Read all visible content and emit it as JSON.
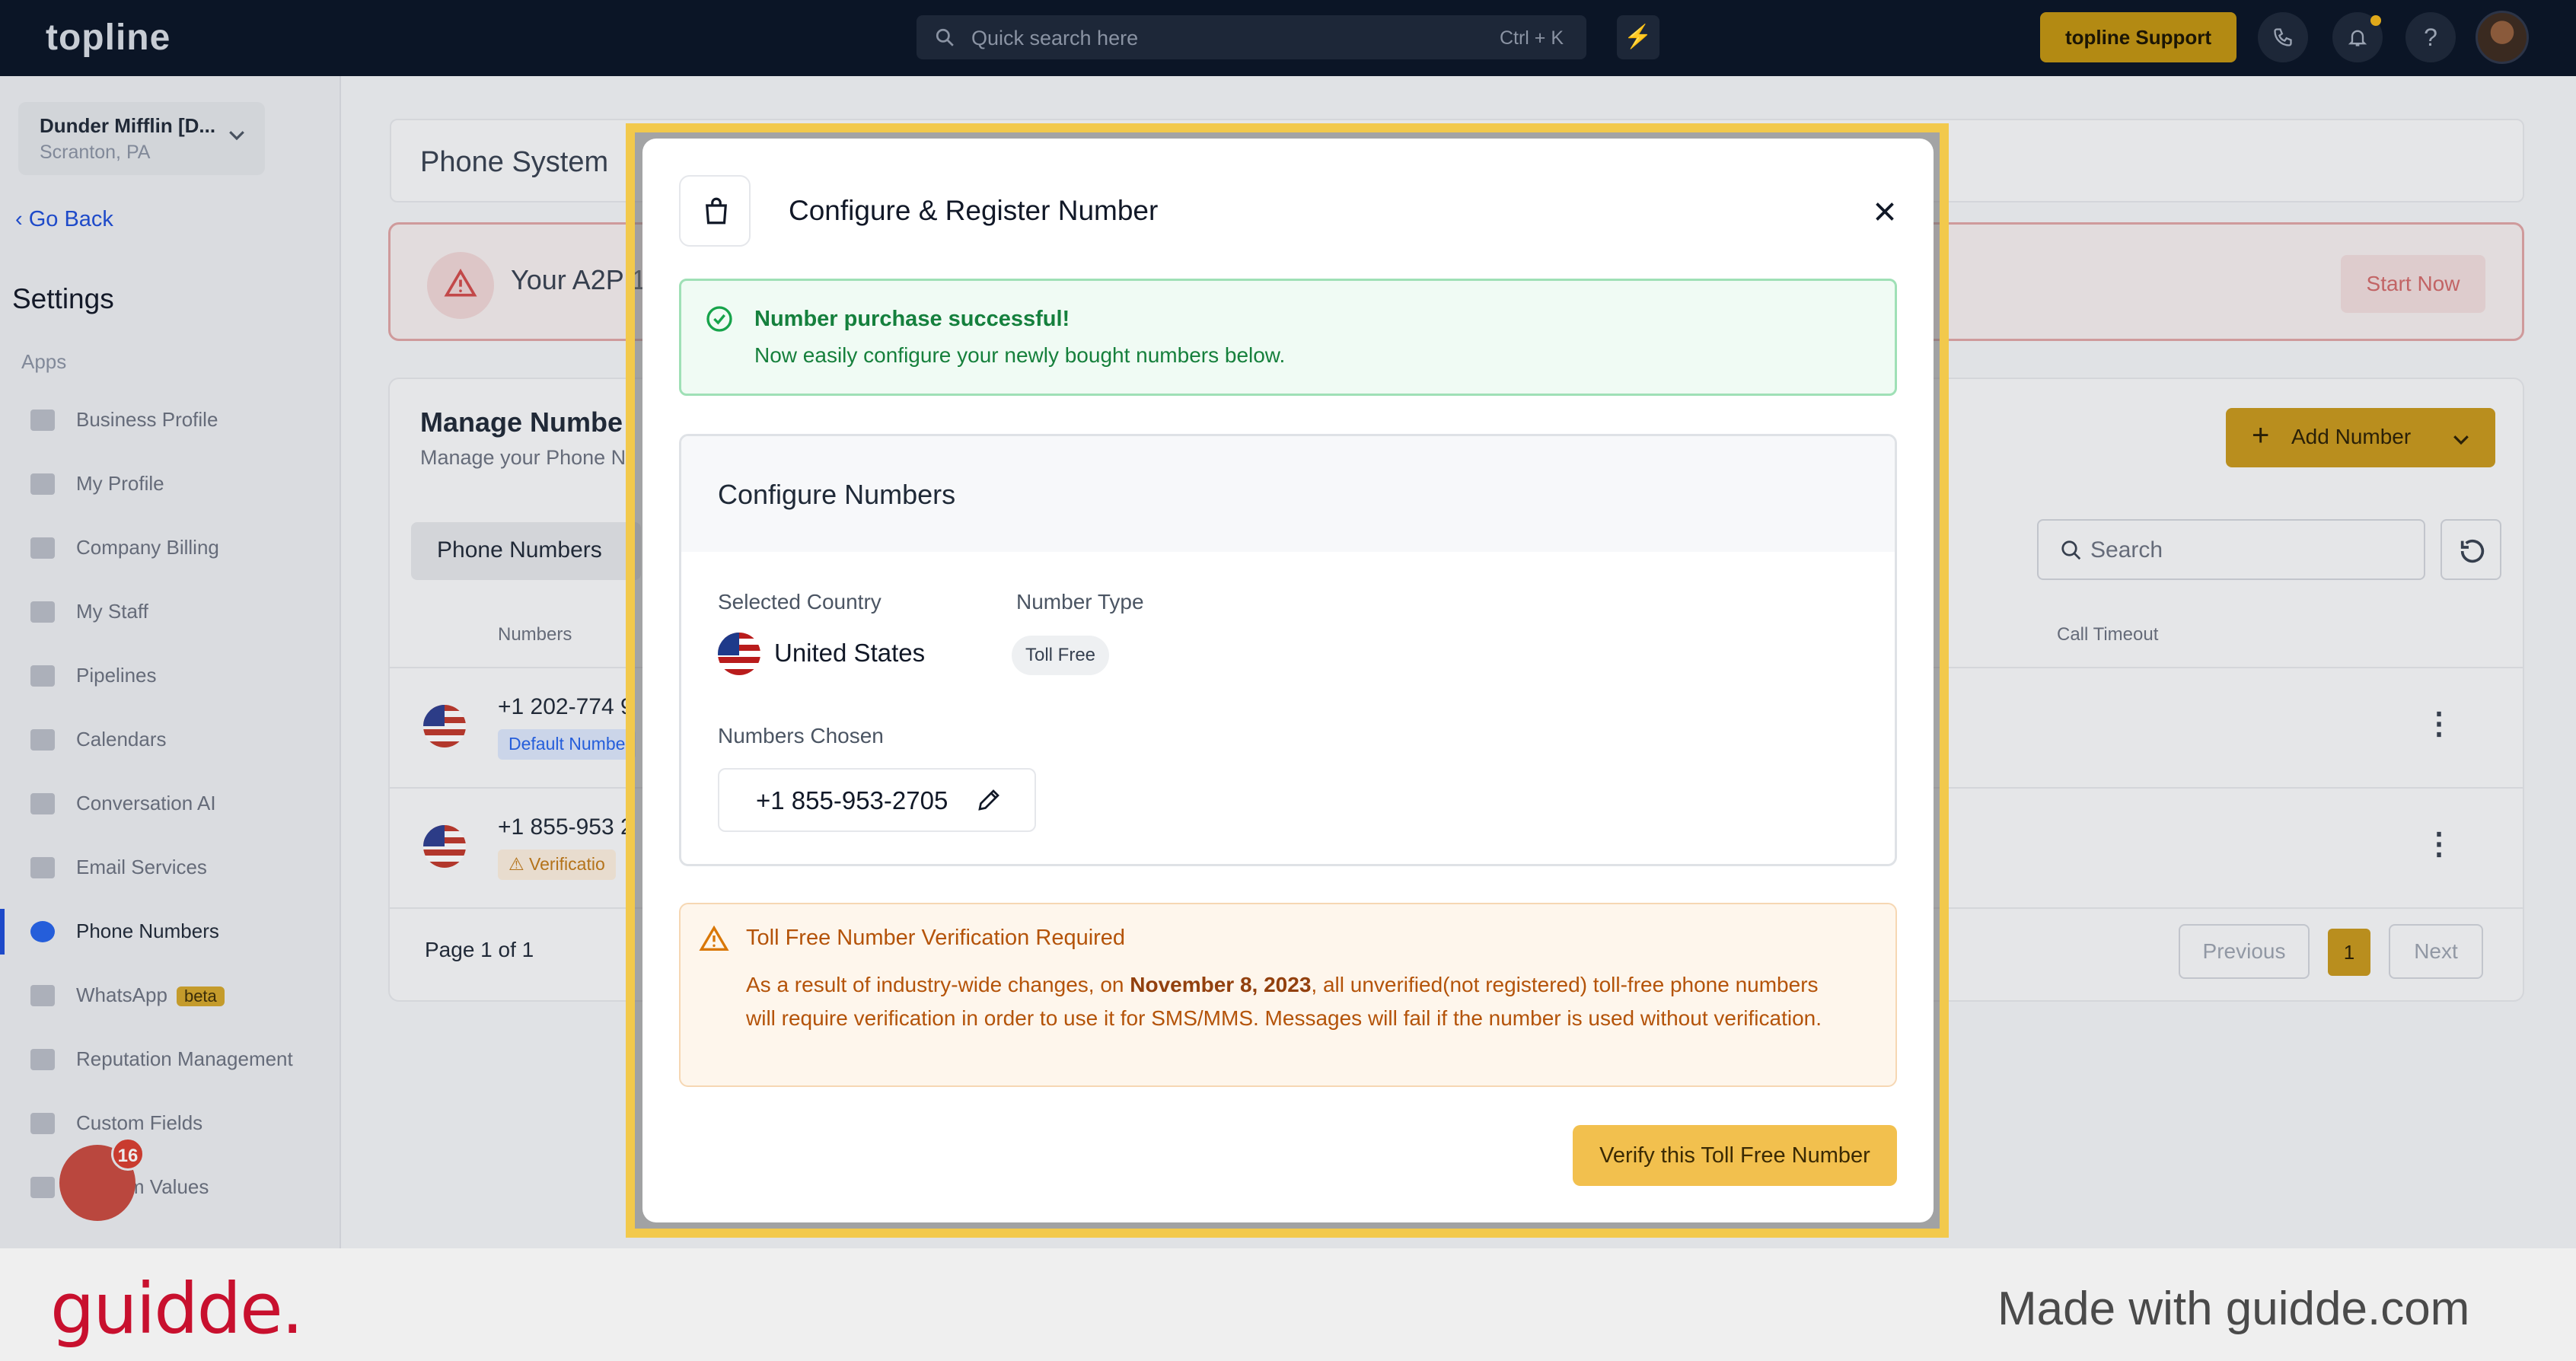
{
  "topbar": {
    "logo": "topline",
    "search_placeholder": "Quick search here",
    "search_shortcut": "Ctrl + K",
    "support_label": "topline Support"
  },
  "sidebar": {
    "account_name": "Dunder Mifflin [D...",
    "account_location": "Scranton, PA",
    "go_back": "Go Back",
    "settings_title": "Settings",
    "section_label": "Apps",
    "items": [
      {
        "label": "Business Profile"
      },
      {
        "label": "My Profile"
      },
      {
        "label": "Company Billing"
      },
      {
        "label": "My Staff"
      },
      {
        "label": "Pipelines"
      },
      {
        "label": "Calendars"
      },
      {
        "label": "Conversation AI"
      },
      {
        "label": "Email Services"
      },
      {
        "label": "Phone Numbers"
      },
      {
        "label": "WhatsApp",
        "badge": "beta"
      },
      {
        "label": "Reputation Management"
      },
      {
        "label": "Custom Fields"
      },
      {
        "label": "Custom Values"
      }
    ],
    "notification_count": "16"
  },
  "main": {
    "page_title": "Phone System",
    "a2p_text": "Your A2P 1",
    "start_now": "Start Now",
    "manage_title": "Manage Numbe",
    "manage_subtitle": "Manage your Phone N",
    "add_number": "Add Number",
    "tab_phone_numbers": "Phone Numbers",
    "search_placeholder": "Search",
    "col_numbers": "Numbers",
    "col_call_timeout": "Call Timeout",
    "rows": [
      {
        "number": "+1 202-774 9",
        "badge": "Default Numbe"
      },
      {
        "number": "+1 855-953 2",
        "badge": "Verificatio"
      }
    ],
    "pagination": {
      "page_of": "Page 1 of 1",
      "previous": "Previous",
      "current": "1",
      "next": "Next"
    }
  },
  "modal": {
    "title": "Configure & Register Number",
    "success_title": "Number purchase successful!",
    "success_text": "Now easily configure your newly bought numbers below.",
    "configure_title": "Configure Numbers",
    "selected_country_label": "Selected Country",
    "selected_country": "United States",
    "number_type_label": "Number Type",
    "number_type": "Toll Free",
    "numbers_chosen_label": "Numbers Chosen",
    "chosen_number": "+1 855-953-2705",
    "warning_title": "Toll Free Number Verification Required",
    "warning_text_1": "As a result of industry-wide changes, on ",
    "warning_date": "November 8, 2023",
    "warning_text_2": ", all unverified(not registered) toll-free phone numbers will require verification in order to use it for SMS/MMS. Messages will fail if the number is used without verification.",
    "verify_button": "Verify this Toll Free Number"
  },
  "footer": {
    "brand": "guidde.",
    "made_with": "Made with guidde.com"
  },
  "colors": {
    "accent": "#f2c94c",
    "success": "#15803d",
    "warning": "#b45309",
    "brand": "#c8102e"
  }
}
